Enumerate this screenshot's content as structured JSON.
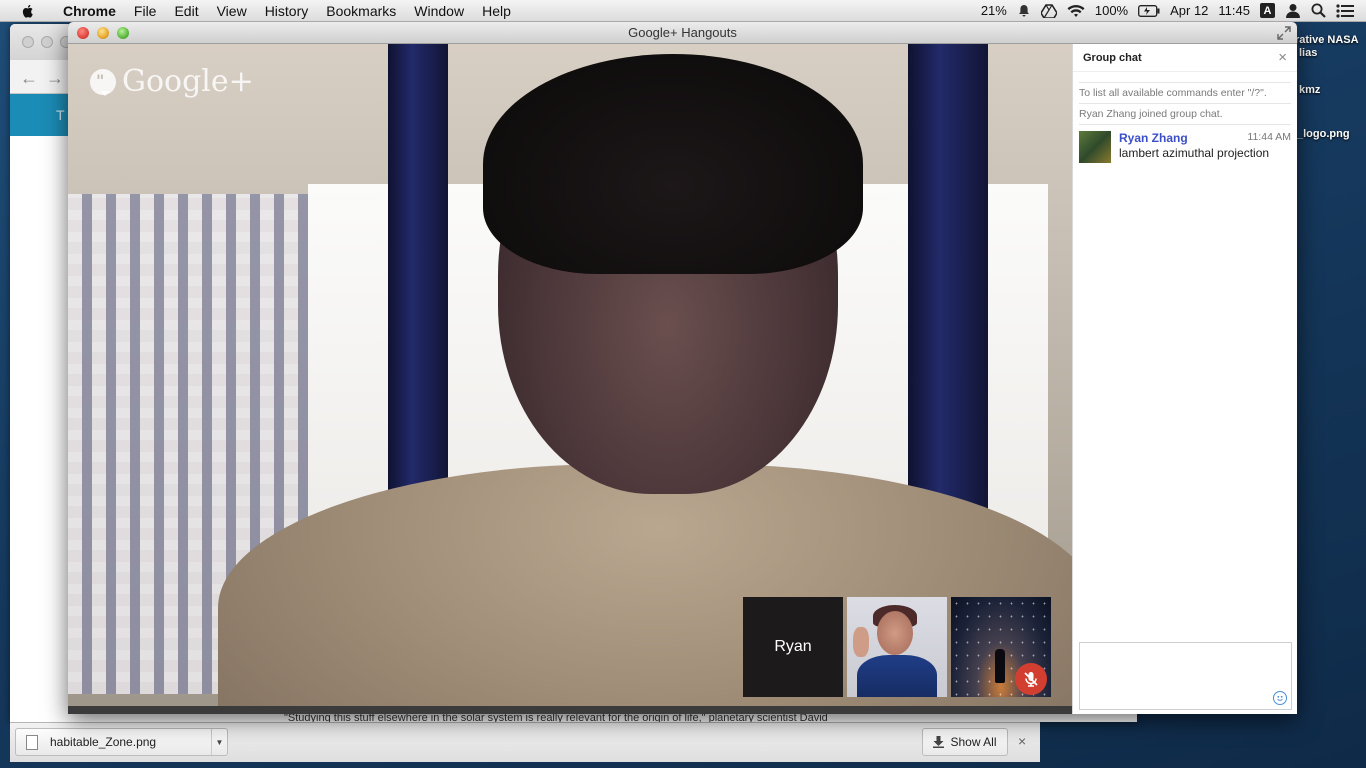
{
  "menubar": {
    "app": "Chrome",
    "items": [
      "File",
      "Edit",
      "View",
      "History",
      "Bookmarks",
      "Window",
      "Help"
    ],
    "battery_percent": "21%",
    "wifi_strength": "100%",
    "date": "Apr 12",
    "time": "11:45",
    "input_source": "A"
  },
  "desktop": {
    "labels": [
      "rative NASA",
      "lias",
      "kmz",
      "_logo.png"
    ]
  },
  "bg_window": {
    "banner_text": "T",
    "article_text": "\"Studying this stuff elsewhere in the solar system is really relevant for the origin of life,\" planetary scientist David"
  },
  "download_shelf": {
    "file_name": "habitable_Zone.png",
    "show_all_label": "Show All",
    "close": "×"
  },
  "hangout": {
    "window_title": "Google+ Hangouts",
    "logo_text": "Google+",
    "logo_glyph": "\"",
    "thumbnails": [
      {
        "label": "Ryan"
      }
    ],
    "chat": {
      "header": "Group chat",
      "close": "×",
      "system_messages": [
        "To list all available commands enter \"/?\".",
        "Ryan Zhang joined group chat."
      ],
      "messages": [
        {
          "name": "Ryan Zhang",
          "time": "11:44 AM",
          "text": "lambert azimuthal projection"
        }
      ]
    }
  }
}
